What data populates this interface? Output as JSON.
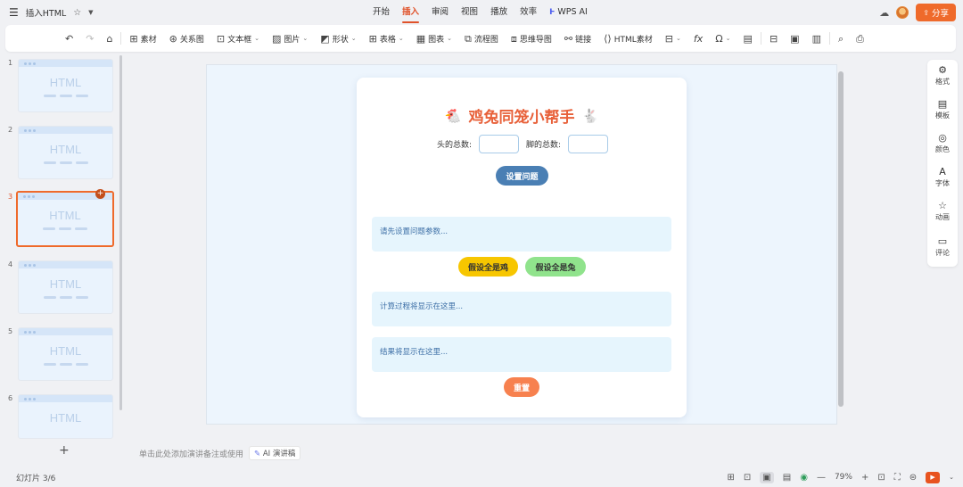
{
  "titlebar": {
    "menu_icon": "hamburger-icon",
    "doc_title": "插入HTML",
    "tabs": [
      {
        "label": "开始",
        "active": false
      },
      {
        "label": "插入",
        "active": true
      },
      {
        "label": "审阅",
        "active": false
      },
      {
        "label": "视图",
        "active": false
      },
      {
        "label": "播放",
        "active": false
      },
      {
        "label": "效率",
        "active": false
      },
      {
        "label": "WPS AI",
        "active": false
      }
    ],
    "share_label": "分享"
  },
  "toolbar": {
    "items": {
      "material": "素材",
      "relation": "关系图",
      "textbox": "文本框",
      "image": "图片",
      "shape": "形状",
      "table": "表格",
      "chart": "图表",
      "flowchart": "流程图",
      "mindmap": "思维导图",
      "link": "链接",
      "html_material": "HTML素材"
    }
  },
  "slides": {
    "thumb_text": "HTML",
    "numbers": [
      "1",
      "2",
      "3",
      "4",
      "5",
      "6"
    ],
    "active_index": 3
  },
  "card": {
    "title": "鸡兔同笼小帮手",
    "heads_label": "头的总数:",
    "feet_label": "脚的总数:",
    "set_button": "设置问题",
    "prompt_text": "请先设置问题参数...",
    "assume_chicken": "假设全是鸡",
    "assume_rabbit": "假设全是兔",
    "process_text": "计算过程将显示在这里...",
    "result_text": "结果将显示在这里...",
    "reset_button": "重置"
  },
  "notes": {
    "placeholder": "单击此处添加演讲备注或使用",
    "ai_label": "AI 演讲稿"
  },
  "right_panel": {
    "format": "格式",
    "template": "模板",
    "color": "颜色",
    "font": "字体",
    "animation": "动画",
    "comment": "评论"
  },
  "statusbar": {
    "slide_count": "幻灯片 3/6",
    "zoom": "79%"
  },
  "colors": {
    "accent": "#e0522a",
    "title": "#e8613a",
    "set_button": "#4a7fb4",
    "chicken_button": "#f7c600",
    "rabbit_button": "#90e38c",
    "reset_button": "#f7814f"
  }
}
